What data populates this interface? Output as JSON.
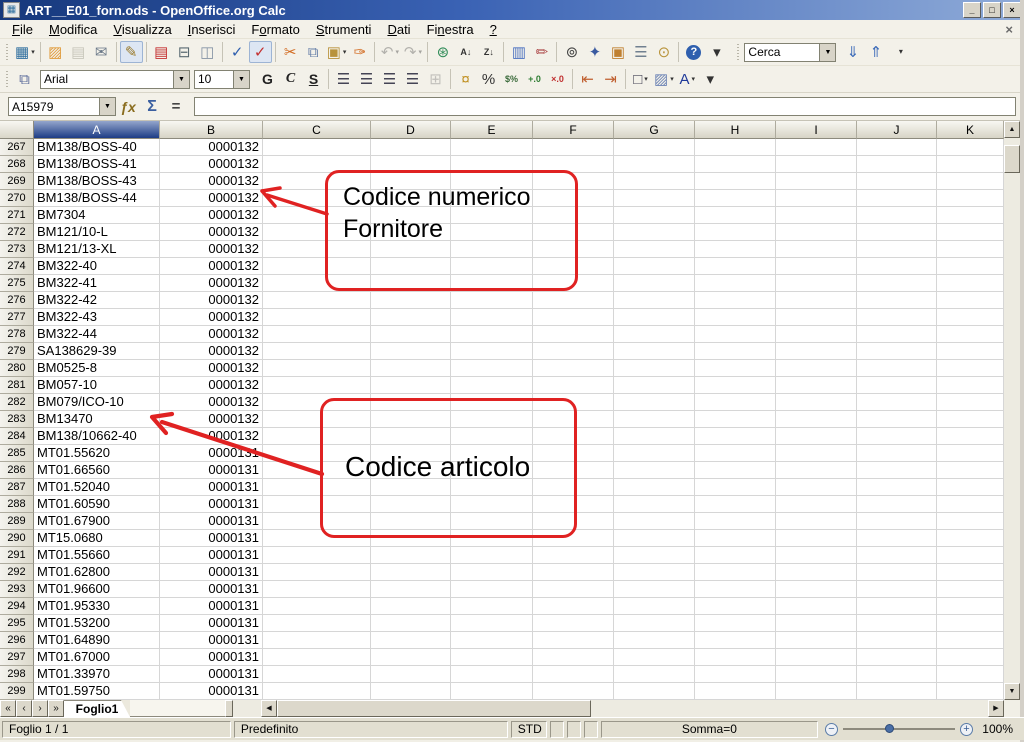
{
  "window": {
    "title": "ART__E01_forn.ods - OpenOffice.org Calc",
    "controls": [
      {
        "name": "minimize-button",
        "glyph": "_"
      },
      {
        "name": "restore-button",
        "glyph": "□"
      },
      {
        "name": "close-button",
        "glyph": "×"
      }
    ]
  },
  "menu_bar": {
    "items": [
      {
        "label": "File",
        "u": 0
      },
      {
        "label": "Modifica",
        "u": 0
      },
      {
        "label": "Visualizza",
        "u": 0
      },
      {
        "label": "Inserisci",
        "u": 0
      },
      {
        "label": "Formato",
        "u": 1
      },
      {
        "label": "Strumenti",
        "u": 0
      },
      {
        "label": "Dati",
        "u": 0
      },
      {
        "label": "Finestra",
        "u": 2
      },
      {
        "label": "?",
        "u": 0
      }
    ],
    "document_close_glyph": "×"
  },
  "standard_toolbar": {
    "buttons": [
      {
        "name": "new-document-icon",
        "glyph": "▦",
        "color": "#2f6f9f",
        "dropdown": true
      },
      {
        "sep": true
      },
      {
        "name": "open-icon",
        "glyph": "▨",
        "color": "#e09a3a"
      },
      {
        "name": "save-icon",
        "glyph": "▤",
        "color": "#8a8878",
        "disabled": true
      },
      {
        "name": "email-icon",
        "glyph": "✉",
        "color": "#6a7888"
      },
      {
        "sep": true
      },
      {
        "name": "edit-mode-icon",
        "glyph": "✎",
        "color": "#9a7a2a",
        "active": true
      },
      {
        "sep": true
      },
      {
        "name": "export-pdf-icon",
        "glyph": "▤",
        "color": "#c43030"
      },
      {
        "name": "print-icon",
        "glyph": "⊟",
        "color": "#5a6a72"
      },
      {
        "name": "page-preview-icon",
        "glyph": "◫",
        "color": "#8593a5"
      },
      {
        "sep": true
      },
      {
        "name": "spellcheck-icon",
        "glyph": "✓",
        "color": "#2f5fae"
      },
      {
        "name": "autospellcheck-icon",
        "glyph": "✓",
        "color": "#c43030",
        "active": true
      },
      {
        "sep": true
      },
      {
        "name": "cut-icon",
        "glyph": "✂",
        "color": "#d2691e"
      },
      {
        "name": "copy-icon",
        "glyph": "⧉",
        "color": "#667fa8"
      },
      {
        "name": "paste-icon",
        "glyph": "▣",
        "color": "#b8923a",
        "dropdown": true
      },
      {
        "name": "format-paintbrush-icon",
        "glyph": "✑",
        "color": "#d2691e"
      },
      {
        "sep": true
      },
      {
        "name": "undo-icon",
        "glyph": "↶",
        "color": "#555",
        "disabled": true,
        "dropdown": true
      },
      {
        "name": "redo-icon",
        "glyph": "↷",
        "color": "#555",
        "disabled": true,
        "dropdown": true
      },
      {
        "sep": true
      },
      {
        "name": "hyperlink-icon",
        "glyph": "⊛",
        "color": "#2e8b57"
      },
      {
        "name": "sort-ascending-icon",
        "glyph": "A↓",
        "color": "#333",
        "small": true
      },
      {
        "name": "sort-descending-icon",
        "glyph": "Z↓",
        "color": "#333",
        "small": true
      },
      {
        "sep": true
      },
      {
        "name": "insert-chart-icon",
        "glyph": "▥",
        "color": "#4a70c0"
      },
      {
        "name": "draw-functions-icon",
        "glyph": "✏",
        "color": "#b05050"
      },
      {
        "sep": true
      },
      {
        "name": "find-replace-icon",
        "glyph": "⊚",
        "color": "#444"
      },
      {
        "name": "navigator-icon",
        "glyph": "✦",
        "color": "#3a5aa0"
      },
      {
        "name": "gallery-icon",
        "glyph": "▣",
        "color": "#c08030"
      },
      {
        "name": "data-sources-icon",
        "glyph": "☰",
        "color": "#708090"
      },
      {
        "name": "zoom-icon",
        "glyph": "⊙",
        "color": "#b8933a"
      },
      {
        "sep": true
      },
      {
        "name": "help-icon",
        "glyph": "?",
        "help": true
      },
      {
        "name": "toolbar-overflow-icon",
        "glyph": "▾",
        "color": "#333"
      }
    ],
    "find": {
      "value": "Cerca",
      "down_glyph": "⇓",
      "up_glyph": "⇑",
      "overflow_glyph": "▾"
    }
  },
  "format_toolbar": {
    "styles_glyph": "⧉",
    "font_name": "Arial",
    "font_size": "10",
    "buttons": [
      {
        "name": "bold-icon",
        "glyph": "G",
        "cls": "b"
      },
      {
        "name": "italic-icon",
        "glyph": "C",
        "cls": "i"
      },
      {
        "name": "underline-icon",
        "glyph": "S",
        "cls": "u"
      },
      {
        "sep": true
      },
      {
        "name": "align-left-icon",
        "glyph": "☰",
        "color": "#445"
      },
      {
        "name": "align-center-icon",
        "glyph": "☰",
        "color": "#445"
      },
      {
        "name": "align-right-icon",
        "glyph": "☰",
        "color": "#445"
      },
      {
        "name": "align-justified-icon",
        "glyph": "☰",
        "color": "#445"
      },
      {
        "name": "merge-cells-icon",
        "glyph": "⊞",
        "color": "#777",
        "disabled": true
      },
      {
        "sep": true
      },
      {
        "name": "currency-format-icon",
        "glyph": "¤",
        "color": "#c09020"
      },
      {
        "name": "percent-format-icon",
        "glyph": "%",
        "color": "#333"
      },
      {
        "name": "standard-format-icon",
        "glyph": "$%",
        "color": "#3a6a3a",
        "small": true
      },
      {
        "name": "add-decimal-icon",
        "glyph": "+.0",
        "color": "#2e7d32",
        "small": true
      },
      {
        "name": "delete-decimal-icon",
        "glyph": "×.0",
        "color": "#c03030",
        "small": true
      },
      {
        "sep": true
      },
      {
        "name": "decrease-indent-icon",
        "glyph": "⇤",
        "color": "#c06030"
      },
      {
        "name": "increase-indent-icon",
        "glyph": "⇥",
        "color": "#c06030"
      },
      {
        "sep": true
      },
      {
        "name": "borders-icon",
        "glyph": "□",
        "color": "#445",
        "dropdown": true
      },
      {
        "name": "background-color-icon",
        "glyph": "▨",
        "color": "#6a82b4",
        "dropdown": true
      },
      {
        "name": "font-color-icon",
        "glyph": "A",
        "color": "#203a9a",
        "dropdown": true
      },
      {
        "name": "toolbar-overflow-icon",
        "glyph": "▾",
        "color": "#333"
      }
    ]
  },
  "formula_bar": {
    "cell_reference": "A15979",
    "formula_value": "",
    "function_wizard_glyph": "ƒx",
    "sum_glyph": "Σ",
    "equals_glyph": "="
  },
  "grid": {
    "column_headers": [
      "A",
      "B",
      "C",
      "D",
      "E",
      "F",
      "G",
      "H",
      "I",
      "J",
      "K"
    ],
    "selected_column": "A",
    "rows": [
      {
        "n": "267",
        "a": "BM138/BOSS-40",
        "b": "0000132"
      },
      {
        "n": "268",
        "a": "BM138/BOSS-41",
        "b": "0000132"
      },
      {
        "n": "269",
        "a": "BM138/BOSS-43",
        "b": "0000132"
      },
      {
        "n": "270",
        "a": "BM138/BOSS-44",
        "b": "0000132"
      },
      {
        "n": "271",
        "a": "BM7304",
        "b": "0000132"
      },
      {
        "n": "272",
        "a": "BM121/10-L",
        "b": "0000132"
      },
      {
        "n": "273",
        "a": "BM121/13-XL",
        "b": "0000132"
      },
      {
        "n": "274",
        "a": "BM322-40",
        "b": "0000132"
      },
      {
        "n": "275",
        "a": "BM322-41",
        "b": "0000132"
      },
      {
        "n": "276",
        "a": "BM322-42",
        "b": "0000132"
      },
      {
        "n": "277",
        "a": "BM322-43",
        "b": "0000132"
      },
      {
        "n": "278",
        "a": "BM322-44",
        "b": "0000132"
      },
      {
        "n": "279",
        "a": "SA138629-39",
        "b": "0000132"
      },
      {
        "n": "280",
        "a": "BM0525-8",
        "b": "0000132"
      },
      {
        "n": "281",
        "a": "BM057-10",
        "b": "0000132"
      },
      {
        "n": "282",
        "a": "BM079/ICO-10",
        "b": "0000132"
      },
      {
        "n": "283",
        "a": "BM13470",
        "b": "0000132"
      },
      {
        "n": "284",
        "a": "BM138/10662-40",
        "b": "0000132"
      },
      {
        "n": "285",
        "a": "MT01.55620",
        "b": "0000131"
      },
      {
        "n": "286",
        "a": "MT01.66560",
        "b": "0000131"
      },
      {
        "n": "287",
        "a": "MT01.52040",
        "b": "0000131"
      },
      {
        "n": "288",
        "a": "MT01.60590",
        "b": "0000131"
      },
      {
        "n": "289",
        "a": "MT01.67900",
        "b": "0000131"
      },
      {
        "n": "290",
        "a": "MT15.0680",
        "b": "0000131"
      },
      {
        "n": "291",
        "a": "MT01.55660",
        "b": "0000131"
      },
      {
        "n": "292",
        "a": "MT01.62800",
        "b": "0000131"
      },
      {
        "n": "293",
        "a": "MT01.96600",
        "b": "0000131"
      },
      {
        "n": "294",
        "a": "MT01.95330",
        "b": "0000131"
      },
      {
        "n": "295",
        "a": "MT01.53200",
        "b": "0000131"
      },
      {
        "n": "296",
        "a": "MT01.64890",
        "b": "0000131"
      },
      {
        "n": "297",
        "a": "MT01.67000",
        "b": "0000131"
      },
      {
        "n": "298",
        "a": "MT01.33970",
        "b": "0000131"
      },
      {
        "n": "299",
        "a": "MT01.59750",
        "b": "0000131"
      }
    ]
  },
  "callouts": {
    "border_color": "#e02222",
    "supplier": {
      "line1": "Codice numerico",
      "line2": "Fornitore"
    },
    "article": {
      "line1": "Codice articolo"
    }
  },
  "sheet_tabs": {
    "active": "Foglio1",
    "nav_glyphs": [
      "«",
      "‹",
      "›",
      "»"
    ]
  },
  "status_bar": {
    "sheet_position": "Foglio 1 / 1",
    "page_style": "Predefinito",
    "mode": "STD",
    "sum": "Somma=0",
    "zoom_level": "100%"
  }
}
